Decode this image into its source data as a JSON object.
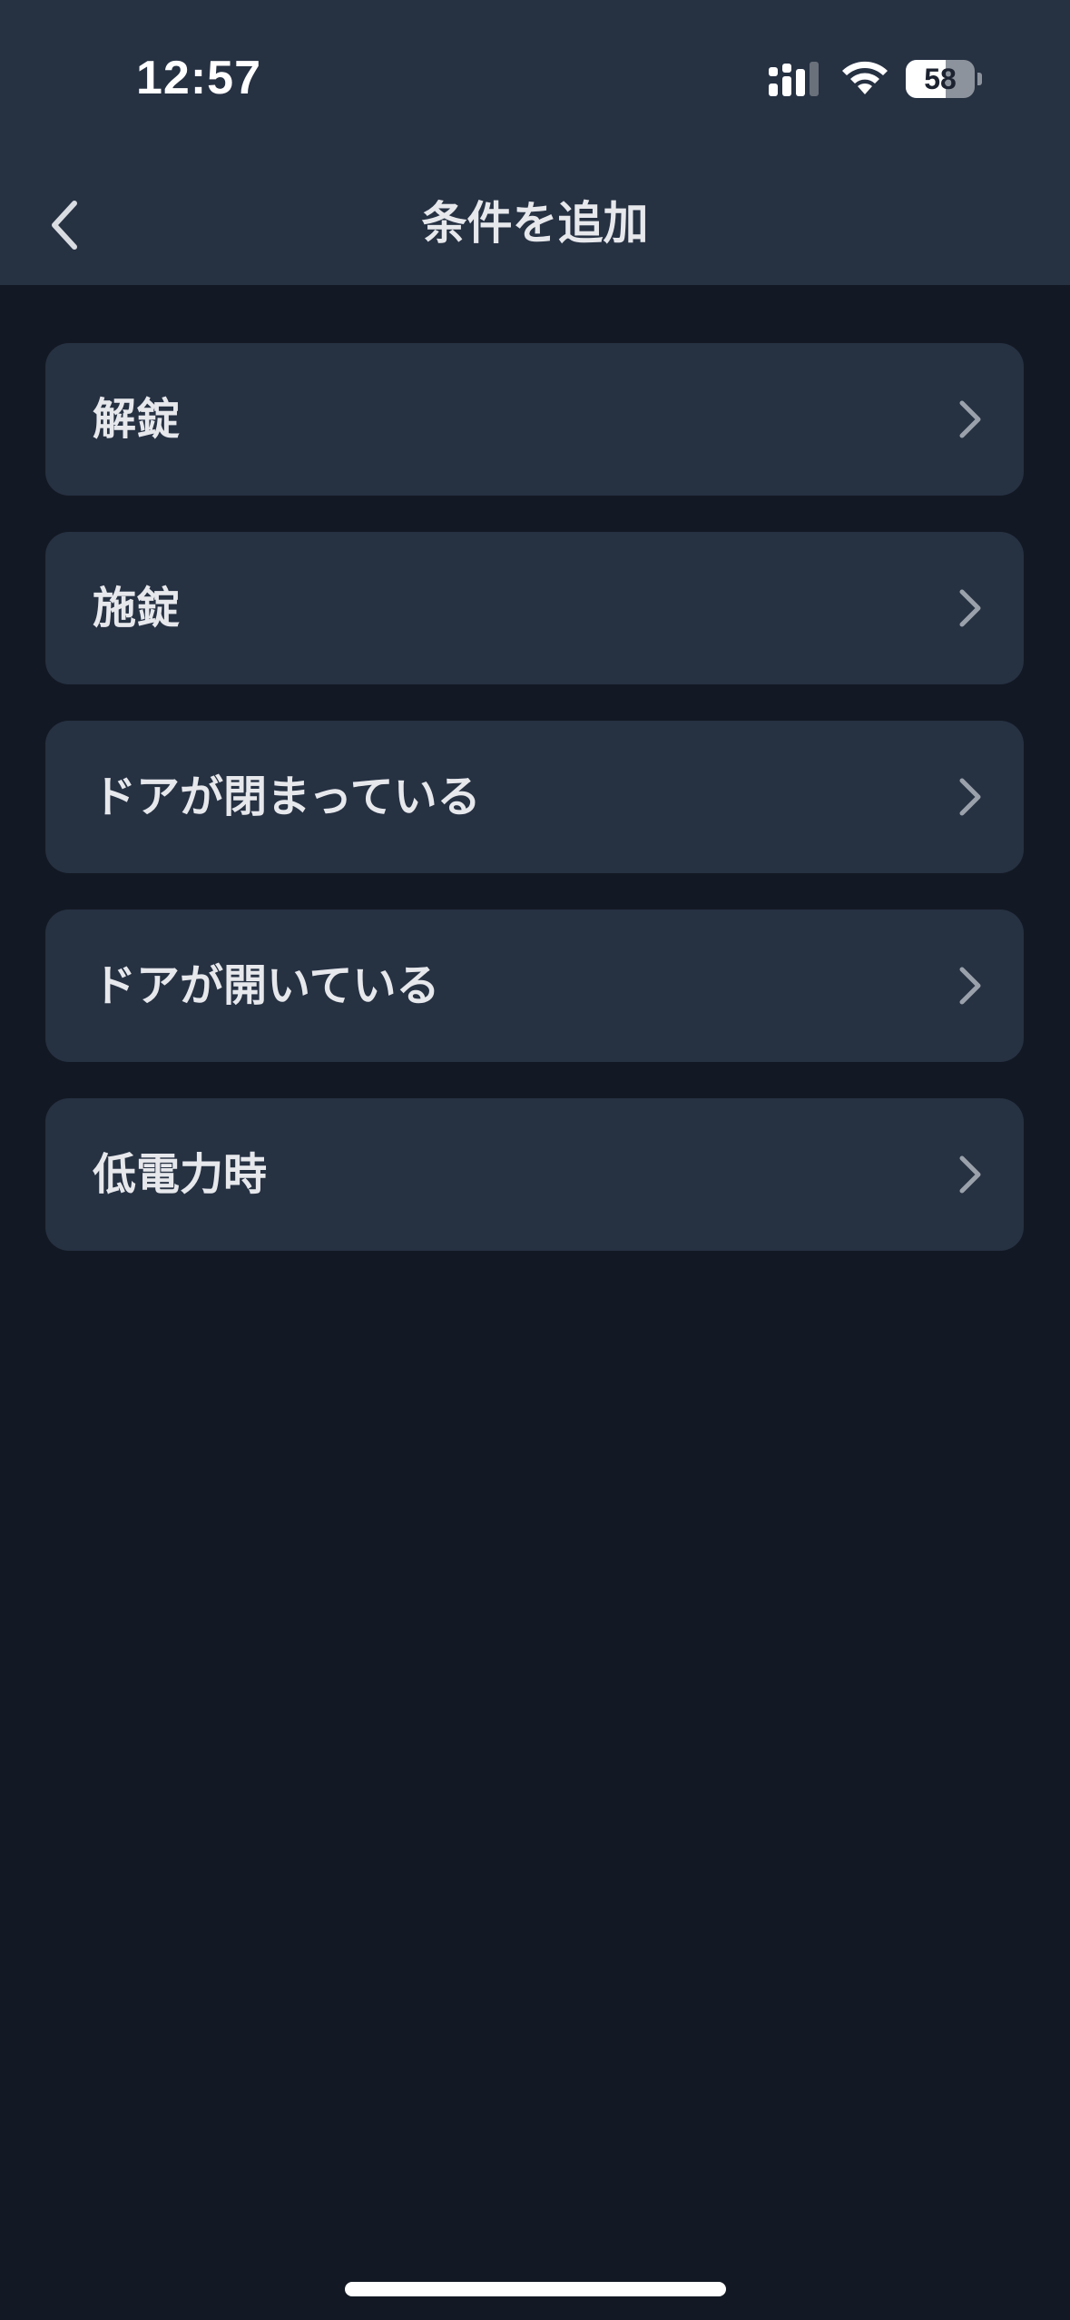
{
  "status_bar": {
    "time": "12:57",
    "battery_level": "58",
    "battery_fraction": 0.58,
    "signal_icon": "cellular-signal-icon",
    "wifi_icon": "wifi-icon",
    "battery_icon": "battery-icon"
  },
  "header": {
    "title": "条件を追加",
    "back_icon": "chevron-left-icon"
  },
  "conditions": [
    {
      "label": "解錠",
      "icon": "chevron-right-icon"
    },
    {
      "label": "施錠",
      "icon": "chevron-right-icon"
    },
    {
      "label": "ドアが閉まっている",
      "icon": "chevron-right-icon"
    },
    {
      "label": "ドアが開いている",
      "icon": "chevron-right-icon"
    },
    {
      "label": "低電力時",
      "icon": "chevron-right-icon"
    }
  ],
  "colors": {
    "background": "#131924",
    "surface": "#263142",
    "text": "#e6e8ec",
    "chevron": "#9aa1ab"
  }
}
